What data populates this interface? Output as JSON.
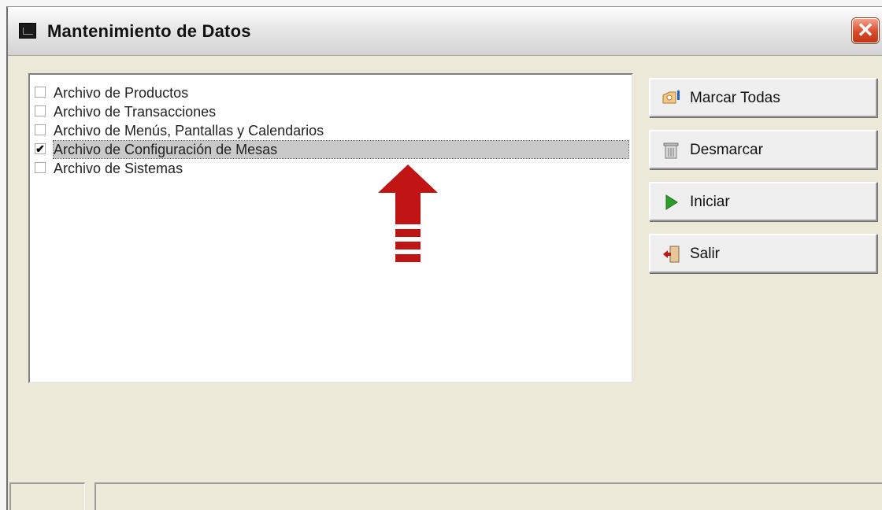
{
  "window": {
    "title": "Mantenimiento de Datos",
    "close_label": "✕"
  },
  "list": {
    "items": [
      {
        "label": "Archivo de Productos",
        "checked": false
      },
      {
        "label": "Archivo de Transacciones",
        "checked": false
      },
      {
        "label": "Archivo de Menús, Pantallas y Calendarios",
        "checked": false
      },
      {
        "label": "Archivo de Configuración de Mesas",
        "checked": true,
        "selected": true
      },
      {
        "label": "Archivo de Sistemas",
        "checked": false
      }
    ]
  },
  "buttons": {
    "mark_all": "Marcar Todas",
    "unmark": "Desmarcar",
    "start": "Iniciar",
    "exit": "Salir"
  },
  "icons": {
    "mark_all": "mark-all-icon",
    "unmark": "trash-icon",
    "start": "play-icon",
    "exit": "exit-door-icon",
    "annotation": "red-arrow-up-icon"
  },
  "colors": {
    "accent_red": "#c11414",
    "close_red": "#d94b2a",
    "play_green": "#2e9e2a"
  }
}
